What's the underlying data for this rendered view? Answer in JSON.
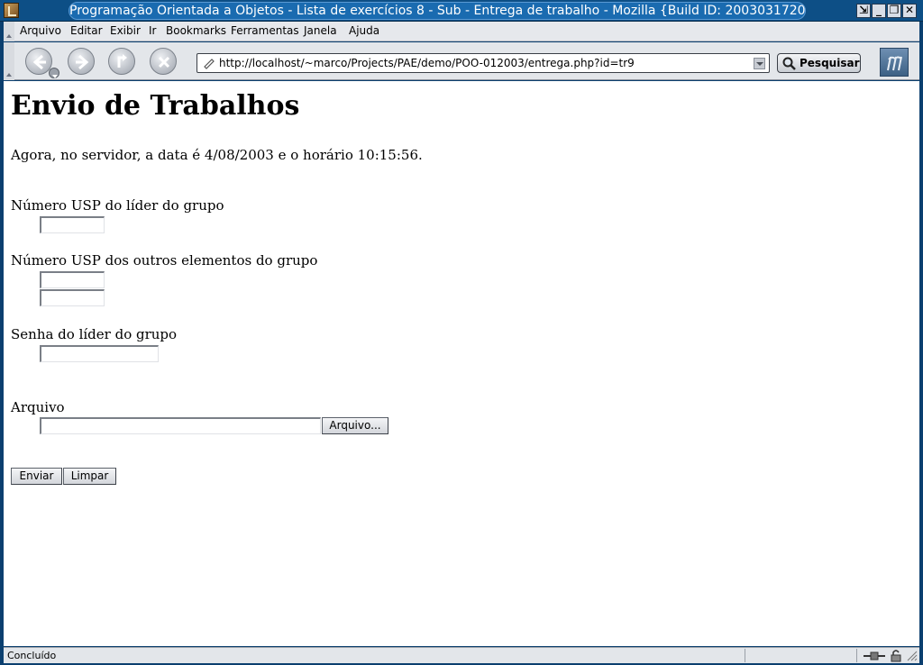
{
  "window": {
    "title": "Programação Orientada a Objetos - Lista de exercícios 8 - Sub - Entrega de trabalho - Mozilla {Build ID: 2003031720}"
  },
  "menu": {
    "items": [
      {
        "label": "Arquivo"
      },
      {
        "label": "Editar"
      },
      {
        "label": "Exibir"
      },
      {
        "label": "Ir"
      },
      {
        "label": "Bookmarks"
      },
      {
        "label": "Ferramentas"
      },
      {
        "label": "Janela"
      },
      {
        "label": "Ajuda"
      }
    ]
  },
  "toolbar": {
    "url": "http://localhost/~marco/Projects/PAE/demo/POO-012003/entrega.php?id=tr9",
    "search_label": "Pesquisar"
  },
  "page": {
    "title": "Envio de Trabalhos",
    "server_time_text": "Agora, no servidor, a data é 4/08/2003 e o horário 10:15:56.",
    "leader_usp_label": "Número USP do líder do grupo",
    "others_usp_label": "Número USP dos outros elementos do grupo",
    "leader_password_label": "Senha do líder do grupo",
    "file_label": "Arquivo",
    "file_button_label": "Arquivo...",
    "submit_label": "Enviar",
    "reset_label": "Limpar"
  },
  "status": {
    "text": "Concluído"
  },
  "colors": {
    "titlebar": "#0d4f86",
    "chrome": "#e3e6ea",
    "content_bg": "#ffffff"
  }
}
